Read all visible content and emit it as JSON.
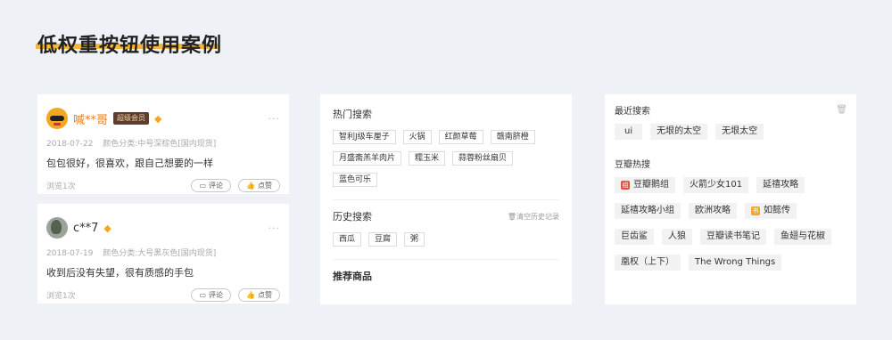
{
  "title": "低权重按钮使用案例",
  "colors": {
    "accent": "#f5b63a",
    "username_orange": "#e67e22",
    "vip_bg": "#5c3d2e"
  },
  "reviews": [
    {
      "username": "喊**哥",
      "badge": "超级会员",
      "date": "2018-07-22",
      "spec": "颜色分类:中号深棕色[国内现货]",
      "text": "包包很好，很喜欢，跟自己想要的一样",
      "views": "浏览1次",
      "comment_label": "评论",
      "like_label": "点赞",
      "more": "···"
    },
    {
      "username": "c**7",
      "badge": "",
      "date": "2018-07-19",
      "spec": "颜色分类:大号黑灰色[国内现货]",
      "text": "收到后没有失望，很有质感的手包",
      "views": "浏览1次",
      "comment_label": "评论",
      "like_label": "点赞",
      "more": "···"
    }
  ],
  "hot_search": {
    "title": "热门搜索",
    "tags": [
      "智利J级车厘子",
      "火锅",
      "红颜草莓",
      "赣南脐橙",
      "月盛斋羔羊肉片",
      "糯玉米",
      "蒜蓉粉丝扇贝",
      "蓝色可乐"
    ]
  },
  "history_search": {
    "title": "历史搜索",
    "clear_label": "清空历史记录",
    "tags": [
      "西瓜",
      "豆腐",
      "粥"
    ]
  },
  "recommend": {
    "title": "推荐商品"
  },
  "recent_search": {
    "title": "最近搜索",
    "tags": [
      "ui",
      "无垠的太空",
      "无垠太空"
    ]
  },
  "douban_hot": {
    "title": "豆瓣热搜",
    "rows": [
      [
        "豆瓣鹅组",
        "火箭少女101",
        "延禧攻略"
      ],
      [
        "延禧攻略小组",
        "欧洲攻略",
        "如懿传"
      ],
      [
        "巨齿鲨",
        "人狼",
        "豆瓣读书笔记",
        "鱼翅与花椒"
      ],
      [
        "凰权（上下）",
        "The Wrong Things"
      ]
    ]
  }
}
